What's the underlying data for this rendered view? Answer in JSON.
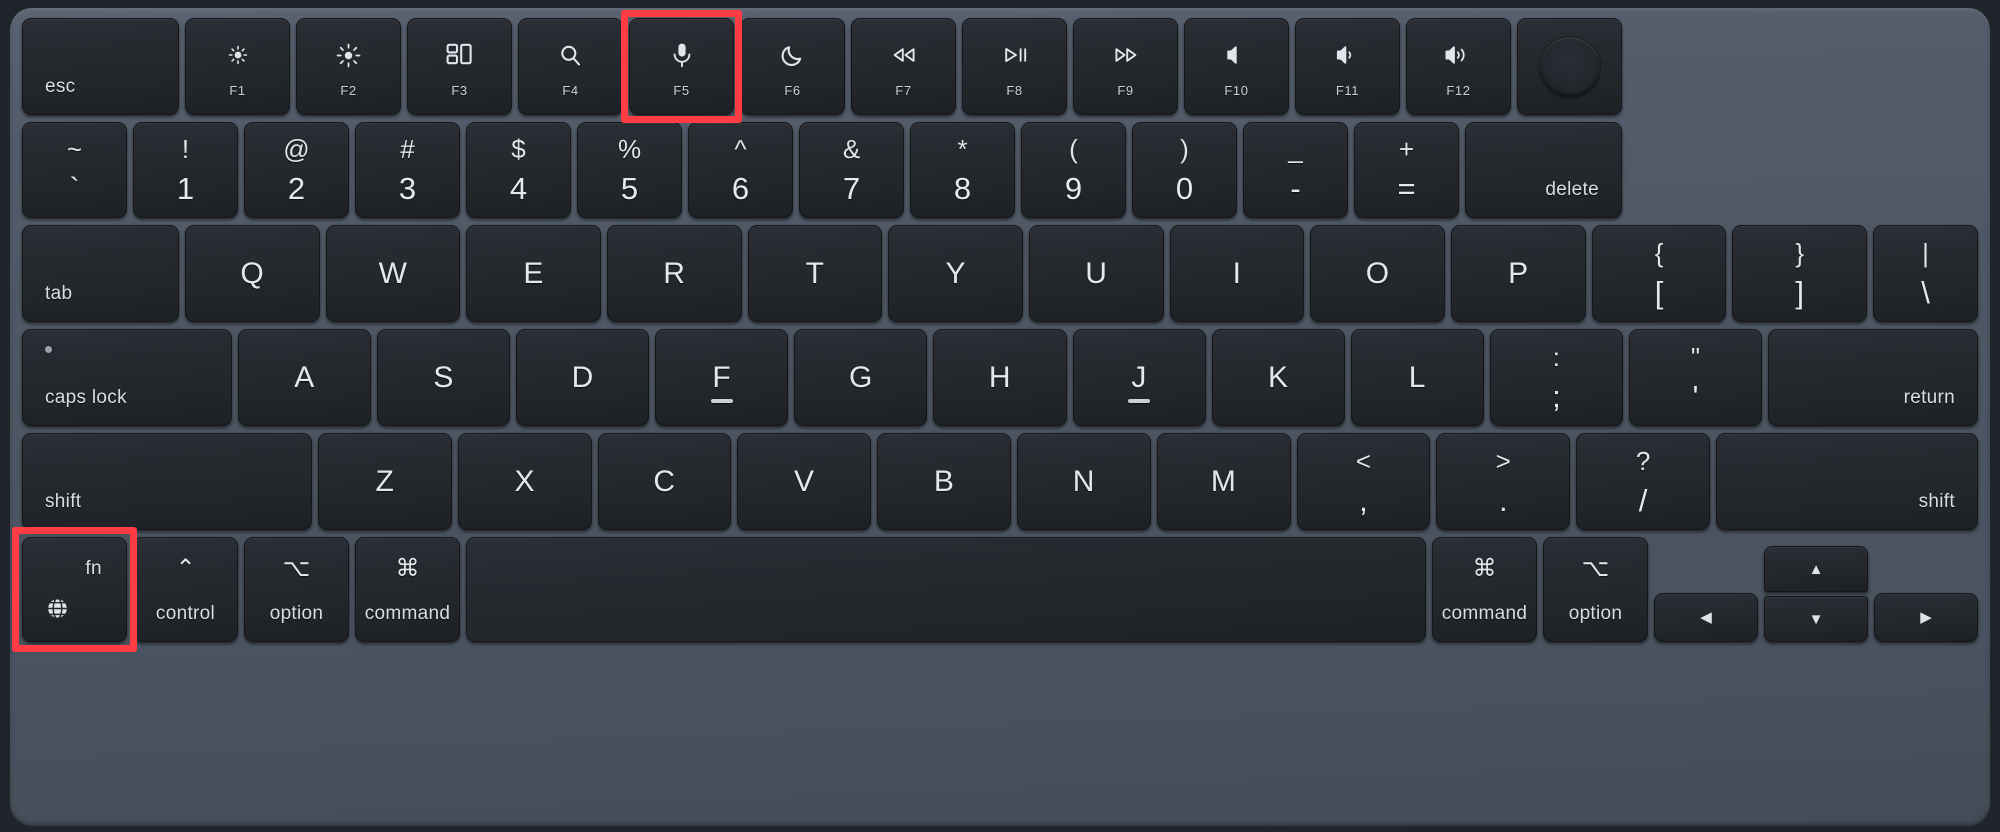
{
  "device": {
    "name": "MacBook keyboard",
    "deck_color": "#4d5663",
    "key_color": "#25292e",
    "label_color": "#e4e8ed",
    "highlight_color": "#ff3b43"
  },
  "function_row": {
    "esc": {
      "label": "esc"
    },
    "keys": [
      {
        "fn_label": "F1",
        "icon": "brightness-down-icon",
        "glyph": "☀",
        "name": "key-f1-brightness-down"
      },
      {
        "fn_label": "F2",
        "icon": "brightness-up-icon",
        "glyph": "☀",
        "name": "key-f2-brightness-up"
      },
      {
        "fn_label": "F3",
        "icon": "mission-control-icon",
        "glyph": "▦",
        "name": "key-f3-mission-control"
      },
      {
        "fn_label": "F4",
        "icon": "spotlight-search-icon",
        "glyph": "⚲",
        "name": "key-f4-spotlight"
      },
      {
        "fn_label": "F5",
        "icon": "microphone-dictation-icon",
        "glyph": "⬤",
        "name": "key-f5-dictation"
      },
      {
        "fn_label": "F6",
        "icon": "do-not-disturb-moon-icon",
        "glyph": "☾",
        "name": "key-f6-do-not-disturb"
      },
      {
        "fn_label": "F7",
        "icon": "rewind-icon",
        "glyph": "⏪",
        "name": "key-f7-rewind"
      },
      {
        "fn_label": "F8",
        "icon": "play-pause-icon",
        "glyph": "▷‖",
        "name": "key-f8-play-pause"
      },
      {
        "fn_label": "F9",
        "icon": "fast-forward-icon",
        "glyph": "⏩",
        "name": "key-f9-fast-forward"
      },
      {
        "fn_label": "F10",
        "icon": "mute-icon",
        "glyph": "ὐ7",
        "name": "key-f10-mute"
      },
      {
        "fn_label": "F11",
        "icon": "volume-down-icon",
        "glyph": "ὐ9",
        "name": "key-f11-volume-down"
      },
      {
        "fn_label": "F12",
        "icon": "volume-up-icon",
        "glyph": "ὐA",
        "name": "key-f12-volume-up"
      }
    ],
    "power": {
      "label": "",
      "icon": "touch-id-power-icon"
    }
  },
  "number_row": [
    {
      "top": "~",
      "bottom": "`",
      "name": "key-grave"
    },
    {
      "top": "!",
      "bottom": "1",
      "name": "key-1"
    },
    {
      "top": "@",
      "bottom": "2",
      "name": "key-2"
    },
    {
      "top": "#",
      "bottom": "3",
      "name": "key-3"
    },
    {
      "top": "$",
      "bottom": "4",
      "name": "key-4"
    },
    {
      "top": "%",
      "bottom": "5",
      "name": "key-5"
    },
    {
      "top": "^",
      "bottom": "6",
      "name": "key-6"
    },
    {
      "top": "&",
      "bottom": "7",
      "name": "key-7"
    },
    {
      "top": "*",
      "bottom": "8",
      "name": "key-8"
    },
    {
      "top": "(",
      "bottom": "9",
      "name": "key-9"
    },
    {
      "top": ")",
      "bottom": "0",
      "name": "key-0"
    },
    {
      "top": "_",
      "bottom": "-",
      "name": "key-minus"
    },
    {
      "top": "+",
      "bottom": "=",
      "name": "key-equal"
    }
  ],
  "number_row_delete": {
    "label": "delete"
  },
  "qwerty_row": {
    "tab": {
      "label": "tab"
    },
    "letters": [
      {
        "glyph": "Q",
        "name": "key-q"
      },
      {
        "glyph": "W",
        "name": "key-w"
      },
      {
        "glyph": "E",
        "name": "key-e"
      },
      {
        "glyph": "R",
        "name": "key-r"
      },
      {
        "glyph": "T",
        "name": "key-t"
      },
      {
        "glyph": "Y",
        "name": "key-y"
      },
      {
        "glyph": "U",
        "name": "key-u"
      },
      {
        "glyph": "I",
        "name": "key-i"
      },
      {
        "glyph": "O",
        "name": "key-o"
      },
      {
        "glyph": "P",
        "name": "key-p"
      }
    ],
    "brackets": [
      {
        "top": "{",
        "bottom": "[",
        "name": "key-bracket-left"
      },
      {
        "top": "}",
        "bottom": "]",
        "name": "key-bracket-right"
      },
      {
        "top": "|",
        "bottom": "\\",
        "name": "key-backslash"
      }
    ]
  },
  "asdf_row": {
    "caps_lock": {
      "label": "caps lock"
    },
    "letters": [
      {
        "glyph": "A",
        "name": "key-a",
        "homebar": false
      },
      {
        "glyph": "S",
        "name": "key-s",
        "homebar": false
      },
      {
        "glyph": "D",
        "name": "key-d",
        "homebar": false
      },
      {
        "glyph": "F",
        "name": "key-f",
        "homebar": true
      },
      {
        "glyph": "G",
        "name": "key-g",
        "homebar": false
      },
      {
        "glyph": "H",
        "name": "key-h",
        "homebar": false
      },
      {
        "glyph": "J",
        "name": "key-j",
        "homebar": true
      },
      {
        "glyph": "K",
        "name": "key-k",
        "homebar": false
      },
      {
        "glyph": "L",
        "name": "key-l",
        "homebar": false
      }
    ],
    "punctuation": [
      {
        "top": ":",
        "bottom": ";",
        "name": "key-semicolon"
      },
      {
        "top": "\"",
        "bottom": "'",
        "name": "key-quote"
      }
    ],
    "return": {
      "label": "return"
    }
  },
  "shift_row": {
    "shift_left": {
      "label": "shift"
    },
    "letters": [
      {
        "glyph": "Z",
        "name": "key-z"
      },
      {
        "glyph": "X",
        "name": "key-x"
      },
      {
        "glyph": "C",
        "name": "key-c"
      },
      {
        "glyph": "V",
        "name": "key-v"
      },
      {
        "glyph": "B",
        "name": "key-b"
      },
      {
        "glyph": "N",
        "name": "key-n"
      },
      {
        "glyph": "M",
        "name": "key-m"
      }
    ],
    "punctuation": [
      {
        "top": "<",
        "bottom": ",",
        "name": "key-comma"
      },
      {
        "top": ">",
        "bottom": ".",
        "name": "key-period"
      },
      {
        "top": "?",
        "bottom": "/",
        "name": "key-slash"
      }
    ],
    "shift_right": {
      "label": "shift"
    }
  },
  "bottom_row": {
    "fn": {
      "label": "fn",
      "icon": "globe-icon"
    },
    "control": {
      "symbol": "⌃",
      "label": "control"
    },
    "option_left": {
      "symbol": "⌥",
      "label": "option"
    },
    "command_left": {
      "symbol": "⌘",
      "label": "command"
    },
    "space": {
      "label": ""
    },
    "command_right": {
      "symbol": "⌘",
      "label": "command"
    },
    "option_right": {
      "symbol": "⌥",
      "label": "option"
    },
    "arrows": {
      "left": {
        "glyph": "◀",
        "name": "key-arrow-left"
      },
      "up": {
        "glyph": "▲",
        "name": "key-arrow-up"
      },
      "down": {
        "glyph": "▼",
        "name": "key-arrow-down"
      },
      "right": {
        "glyph": "▶",
        "name": "key-arrow-right"
      }
    }
  },
  "annotations": [
    {
      "target": "key-f5-dictation",
      "color": "#ff3b43",
      "name": "highlight-f5-dictation"
    },
    {
      "target": "key-fn",
      "color": "#ff3b43",
      "name": "highlight-fn-globe"
    }
  ]
}
